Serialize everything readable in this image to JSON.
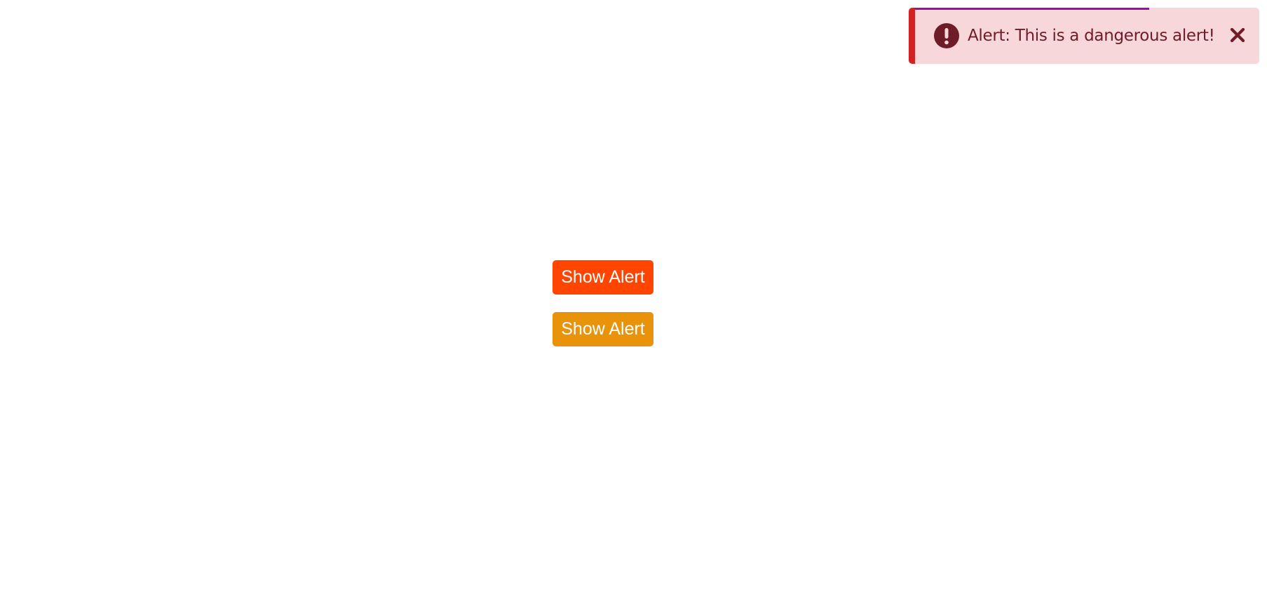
{
  "alert": {
    "message": "Alert: This is a dangerous alert!",
    "icon": "exclamation-circle-icon",
    "close_icon": "close-icon",
    "progress_fraction": 0.68,
    "colors": {
      "background": "#f8d7da",
      "accent": "#d32222",
      "progress": "#9c0f99",
      "text": "#6e1c27",
      "icon": "#6e1c27"
    }
  },
  "buttons": [
    {
      "label": "Show Alert",
      "color": "#ff4500"
    },
    {
      "label": "Show Alert",
      "color": "#e8930a"
    }
  ]
}
